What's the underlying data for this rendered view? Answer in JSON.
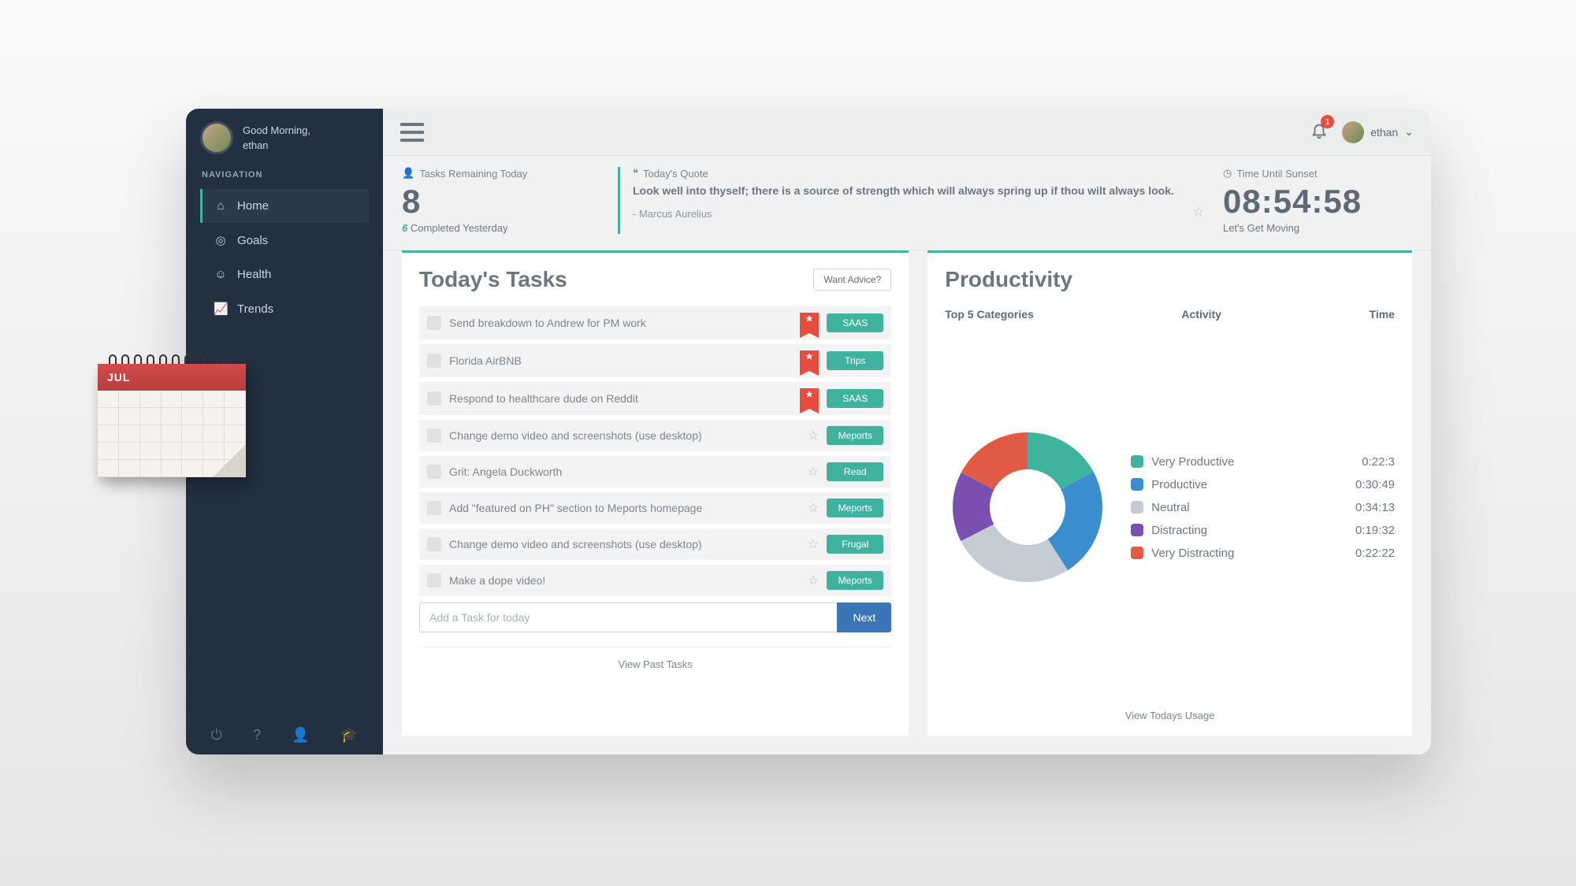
{
  "user": {
    "greeting": "Good Morning,",
    "name": "ethan"
  },
  "sidebar": {
    "heading": "NAVIGATION",
    "items": [
      {
        "label": "Home",
        "icon": "home-icon",
        "active": true
      },
      {
        "label": "Goals",
        "icon": "target-icon",
        "active": false
      },
      {
        "label": "Health",
        "icon": "smile-icon",
        "active": false
      },
      {
        "label": "Trends",
        "icon": "chart-icon",
        "active": false
      }
    ]
  },
  "topbar": {
    "notifications": "1",
    "username": "ethan"
  },
  "summary": {
    "tasks_title": "Tasks Remaining Today",
    "tasks_count": "8",
    "tasks_yesterday_count": "6",
    "tasks_yesterday_text": "Completed Yesterday",
    "quote_title": "Today's Quote",
    "quote_body": "Look well into thyself; there is a source of strength which will always spring up if thou wilt always look.",
    "quote_author": "- Marcus Aurelius",
    "time_title": "Time Until Sunset",
    "time_value": "08:54:58",
    "time_sub": "Let's Get Moving"
  },
  "tasks_panel": {
    "title": "Today's Tasks",
    "advice_btn": "Want Advice?",
    "add_placeholder": "Add a Task for today",
    "next_btn": "Next",
    "past_link": "View Past Tasks",
    "items": [
      {
        "text": "Send breakdown to Andrew for PM work",
        "tag": "SAAS",
        "ribbon": true
      },
      {
        "text": "Florida AirBNB",
        "tag": "Trips",
        "ribbon": true
      },
      {
        "text": "Respond to healthcare dude on Reddit",
        "tag": "SAAS",
        "ribbon": true
      },
      {
        "text": "Change demo video and screenshots (use desktop)",
        "tag": "Meports",
        "ribbon": false
      },
      {
        "text": "Grit: Angela Duckworth",
        "tag": "Read",
        "ribbon": false
      },
      {
        "text": "Add \"featured on PH\" section to Meports homepage",
        "tag": "Meports",
        "ribbon": false
      },
      {
        "text": "Change demo video and screenshots (use desktop)",
        "tag": "Frugal",
        "ribbon": false
      },
      {
        "text": "Make a dope video!",
        "tag": "Meports",
        "ribbon": false
      }
    ]
  },
  "productivity": {
    "title": "Productivity",
    "col_categories": "Top 5 Categories",
    "col_activity": "Activity",
    "col_time": "Time",
    "usage_link": "View Todays Usage"
  },
  "chart_data": {
    "type": "pie",
    "title": "Productivity",
    "series": [
      {
        "name": "Very Productive",
        "time": "0:22:3",
        "seconds": 1323,
        "color": "#3fb39d"
      },
      {
        "name": "Productive",
        "time": "0:30:49",
        "seconds": 1849,
        "color": "#3a8ecf"
      },
      {
        "name": "Neutral",
        "time": "0:34:13",
        "seconds": 2053,
        "color": "#c5ccd3"
      },
      {
        "name": "Distracting",
        "time": "0:19:32",
        "seconds": 1172,
        "color": "#7b4fb0"
      },
      {
        "name": "Very Distracting",
        "time": "0:22:22",
        "seconds": 1342,
        "color": "#e05a45"
      }
    ]
  },
  "overlay": {
    "month": "JUL"
  }
}
